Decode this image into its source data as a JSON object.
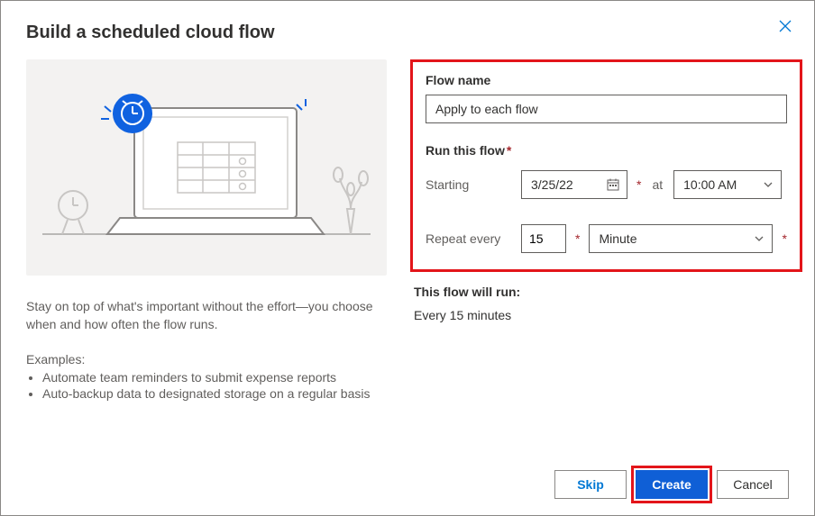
{
  "title": "Build a scheduled cloud flow",
  "description": "Stay on top of what's important without the effort—you choose when and how often the flow runs.",
  "examples_label": "Examples:",
  "examples": [
    "Automate team reminders to submit expense reports",
    "Auto-backup data to designated storage on a regular basis"
  ],
  "form": {
    "flow_name_label": "Flow name",
    "flow_name_value": "Apply to each flow",
    "run_label": "Run this flow",
    "starting_label": "Starting",
    "starting_date": "3/25/22",
    "at_label": "at",
    "starting_time": "10:00 AM",
    "repeat_label": "Repeat every",
    "repeat_value": "15",
    "repeat_unit": "Minute"
  },
  "summary": {
    "label": "This flow will run:",
    "text": "Every 15 minutes"
  },
  "buttons": {
    "skip": "Skip",
    "create": "Create",
    "cancel": "Cancel"
  }
}
